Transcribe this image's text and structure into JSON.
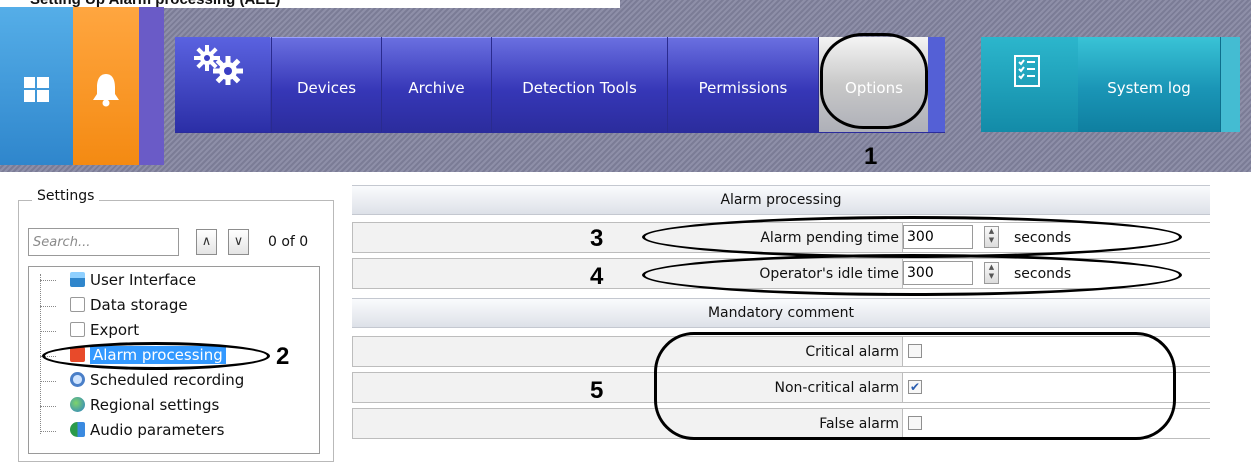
{
  "caption": "Setting Up Alarm processing (AEE)",
  "menu": {
    "items": [
      {
        "label": "Devices"
      },
      {
        "label": "Archive"
      },
      {
        "label": "Detection Tools"
      },
      {
        "label": "Permissions"
      },
      {
        "label": "Options",
        "selected": true
      }
    ],
    "system_log": "System log",
    "icons": [
      "windows-icon",
      "bell-icon",
      "gears-icon",
      "checklist-icon"
    ]
  },
  "settings": {
    "legend": "Settings",
    "search_placeholder": "Search...",
    "count": "0 of 0",
    "tree": [
      {
        "label": "User Interface"
      },
      {
        "label": "Data storage"
      },
      {
        "label": "Export"
      },
      {
        "label": "Alarm processing",
        "selected": true
      },
      {
        "label": "Scheduled recording"
      },
      {
        "label": "Regional settings"
      },
      {
        "label": "Audio parameters"
      }
    ]
  },
  "alarm": {
    "header": "Alarm processing",
    "pending_label": "Alarm pending time",
    "pending_value": "300",
    "idle_label": "Operator's idle time",
    "idle_value": "300",
    "unit": "seconds"
  },
  "comment": {
    "header": "Mandatory comment",
    "critical_label": "Critical alarm",
    "critical_checked": false,
    "noncritical_label": "Non-critical alarm",
    "noncritical_checked": true,
    "false_label": "False alarm",
    "false_checked": false
  },
  "annotations": [
    "1",
    "2",
    "3",
    "4",
    "5"
  ],
  "colors": {
    "selection": "#3399ff",
    "menu": "#3637b7",
    "system_log": "#1a95b6"
  }
}
